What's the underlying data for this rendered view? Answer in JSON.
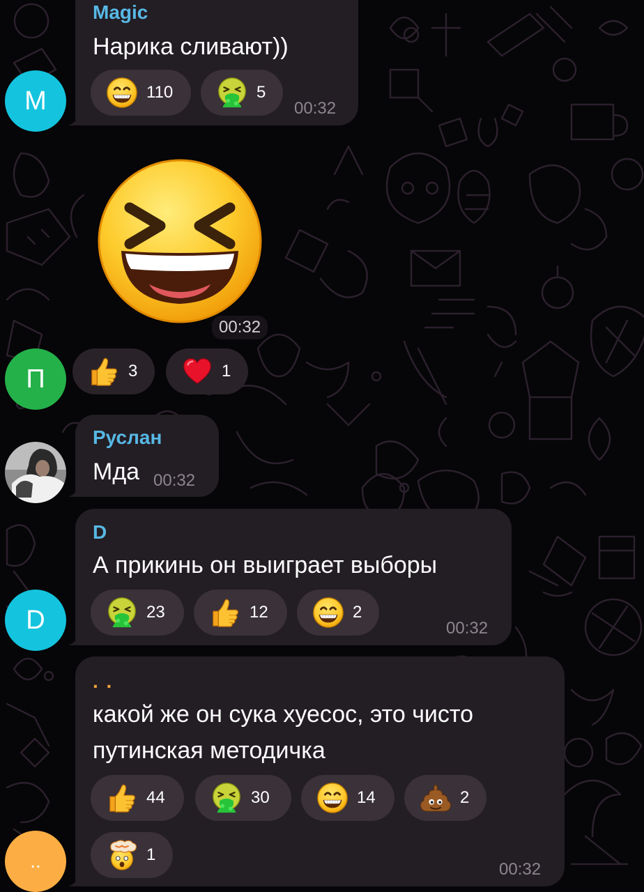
{
  "messages": [
    {
      "sender": "Magic",
      "text": "Нарика сливают))",
      "time": "00:32",
      "avatar_letter": "M",
      "avatar_color": "#14c4de",
      "reactions": [
        {
          "emoji": "grinning-face",
          "count": "110"
        },
        {
          "emoji": "vomiting-face",
          "count": "5"
        }
      ]
    },
    {
      "sticker": "laughing-squinting-face",
      "time": "00:32",
      "avatar_letter": "П",
      "avatar_color": "#24b14a",
      "reactions": [
        {
          "emoji": "thumbs-up",
          "count": "3"
        },
        {
          "emoji": "red-heart",
          "count": "1"
        }
      ]
    },
    {
      "sender": "Руслан",
      "text": "Мда",
      "time": "00:32"
    },
    {
      "sender": "D",
      "text": "А прикинь он выиграет выборы",
      "time": "00:32",
      "avatar_letter": "D",
      "avatar_color": "#14c4de",
      "reactions": [
        {
          "emoji": "vomiting-face",
          "count": "23"
        },
        {
          "emoji": "thumbs-up",
          "count": "12"
        },
        {
          "emoji": "grinning-face",
          "count": "2"
        }
      ]
    },
    {
      "sender": ". .",
      "sender_color": "#f0a33a",
      "text_lines": [
        "какой же он сука хуесос, это чисто",
        "путинская методичка"
      ],
      "time": "00:32",
      "avatar_letter": "..",
      "avatar_color": "#fcae44",
      "reactions": [
        {
          "emoji": "thumbs-up",
          "count": "44"
        },
        {
          "emoji": "vomiting-face",
          "count": "30"
        },
        {
          "emoji": "grinning-face",
          "count": "14"
        },
        {
          "emoji": "pile-of-poo",
          "count": "2"
        },
        {
          "emoji": "exploding-head",
          "count": "1"
        }
      ]
    }
  ],
  "colors": {
    "background": "#060507",
    "bubble": "#231d24",
    "reaction": "#3a3139",
    "sender_name": "#57b8e4",
    "timestamp": "#8d868f"
  }
}
